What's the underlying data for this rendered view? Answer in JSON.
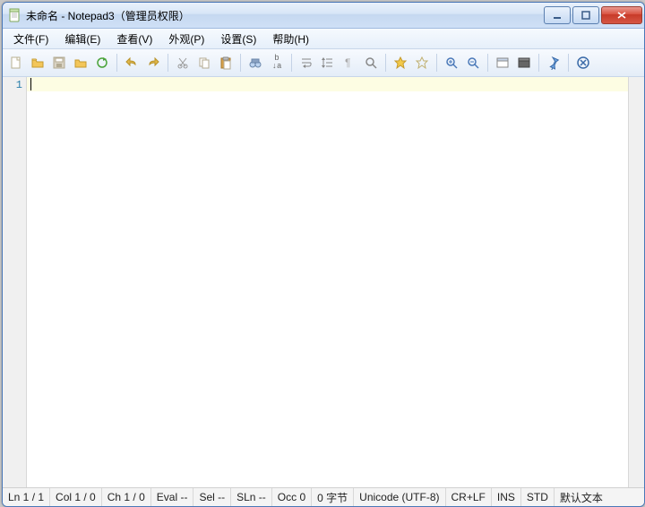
{
  "title": "未命名 - Notepad3（管理员权限）",
  "menu": {
    "file": "文件(F)",
    "edit": "编辑(E)",
    "view": "查看(V)",
    "appearance": "外观(P)",
    "settings": "设置(S)",
    "help": "帮助(H)"
  },
  "gutter": {
    "line1": "1"
  },
  "status": {
    "ln": "Ln  1 / 1",
    "col": "Col  1 / 0",
    "ch": "Ch  1 / 0",
    "eval": "Eval  --",
    "sel": "Sel  --",
    "sln": "SLn  --",
    "occ": "Occ  0",
    "bytes": "0 字节",
    "enc": "Unicode (UTF-8)",
    "eol": "CR+LF",
    "ins": "INS",
    "std": "STD",
    "scheme": "默认文本"
  }
}
